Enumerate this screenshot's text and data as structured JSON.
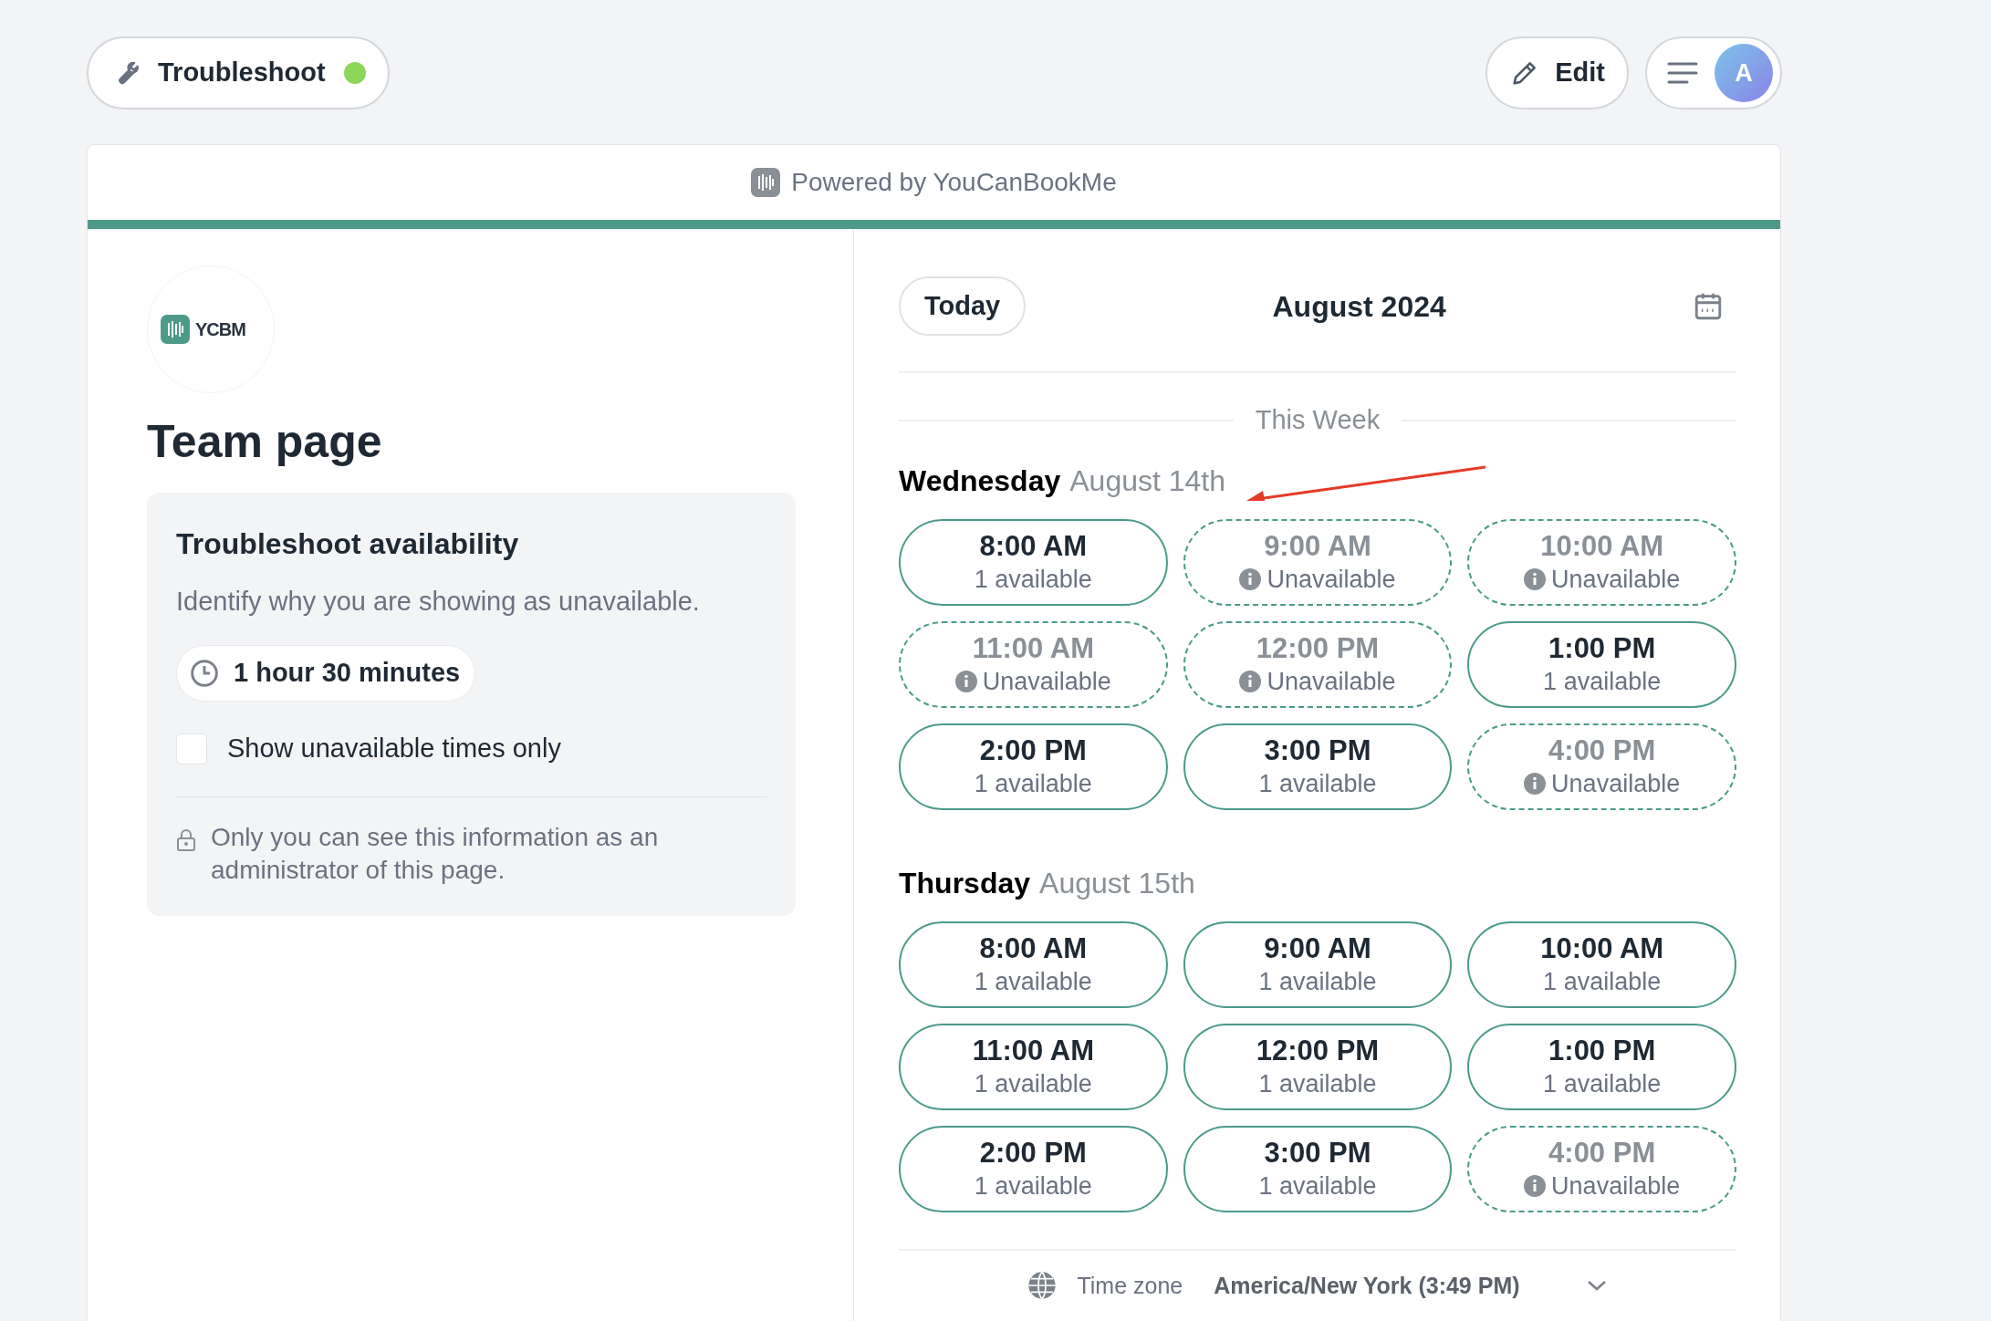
{
  "top_bar": {
    "troubleshoot": {
      "label": "Troubleshoot",
      "color": "#8cd65a"
    },
    "edit_button": "Edit",
    "avatar": "A"
  },
  "banner": {
    "text": "Powered by YouCanBookMe"
  },
  "left": {
    "logo": "YCBM",
    "title": "Team page",
    "panel": {
      "heading": "Troubleshoot availability",
      "description": "Identify why you are showing as unavailable.",
      "duration": "1 hour 30 minutes",
      "checkbox": {
        "label": "Show unavailable times only",
        "checked": false
      },
      "note": "Only you can see this information as an administrator of this page."
    }
  },
  "calendar": {
    "today_button": "Today",
    "month": "August 2024",
    "section": "This Week",
    "days": [
      {
        "weekday": "Wednesday",
        "date": "August 14th",
        "slots": [
          {
            "time": "8:00 AM",
            "status": "1 available",
            "available": true
          },
          {
            "time": "9:00 AM",
            "status": "Unavailable",
            "available": false
          },
          {
            "time": "10:00 AM",
            "status": "Unavailable",
            "available": false
          },
          {
            "time": "11:00 AM",
            "status": "Unavailable",
            "available": false
          },
          {
            "time": "12:00 PM",
            "status": "Unavailable",
            "available": false
          },
          {
            "time": "1:00 PM",
            "status": "1 available",
            "available": true
          },
          {
            "time": "2:00 PM",
            "status": "1 available",
            "available": true
          },
          {
            "time": "3:00 PM",
            "status": "1 available",
            "available": true
          },
          {
            "time": "4:00 PM",
            "status": "Unavailable",
            "available": false
          }
        ]
      },
      {
        "weekday": "Thursday",
        "date": "August 15th",
        "slots": [
          {
            "time": "8:00 AM",
            "status": "1 available",
            "available": true
          },
          {
            "time": "9:00 AM",
            "status": "1 available",
            "available": true
          },
          {
            "time": "10:00 AM",
            "status": "1 available",
            "available": true
          },
          {
            "time": "11:00 AM",
            "status": "1 available",
            "available": true
          },
          {
            "time": "12:00 PM",
            "status": "1 available",
            "available": true
          },
          {
            "time": "1:00 PM",
            "status": "1 available",
            "available": true
          },
          {
            "time": "2:00 PM",
            "status": "1 available",
            "available": true
          },
          {
            "time": "3:00 PM",
            "status": "1 available",
            "available": true
          },
          {
            "time": "4:00 PM",
            "status": "Unavailable",
            "available": false
          }
        ]
      }
    ],
    "timezone": {
      "label": "Time zone",
      "value": "America/New York (3:49 PM)"
    }
  }
}
